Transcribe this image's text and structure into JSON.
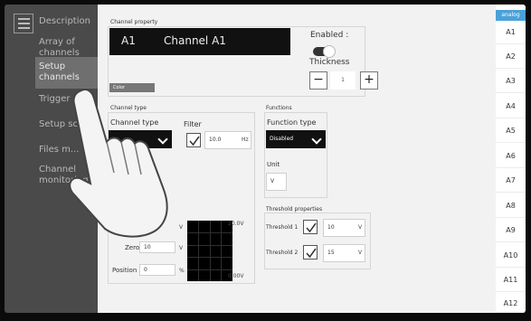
{
  "sidebar": {
    "items": [
      {
        "label": "Description"
      },
      {
        "label": "Array of channels"
      },
      {
        "label": "Setup channels"
      },
      {
        "label": "Trigger"
      },
      {
        "label": "Setup scre..."
      },
      {
        "label": "Files m..."
      },
      {
        "label": "Channel monitoring"
      }
    ]
  },
  "channel_property": {
    "title": "Channel property",
    "channel_id": "A1",
    "channel_name": "Channel A1",
    "enabled_label": "Enabled :",
    "thickness_label": "Thickness",
    "minus": "−",
    "thickness_value": "1",
    "plus": "+",
    "color_label": "Color"
  },
  "channel_type": {
    "title": "Channel type",
    "type_label": "Channel type",
    "filter_label": "Filter",
    "filter_value": "10.0",
    "filter_unit": "Hz",
    "gain_unit": "V",
    "zero_label": "Zero",
    "zero_value": "10",
    "zero_unit": "V",
    "position_label": "Position",
    "position_value": "0",
    "position_unit": "%",
    "scale_max": "20.0V",
    "scale_min": "0.00V"
  },
  "functions": {
    "title": "Functions",
    "type_label": "Function type",
    "type_value": "Disabled",
    "unit_label": "Unit",
    "unit_value": "V"
  },
  "threshold": {
    "title": "Threshold properties",
    "t1_label": "Threshold 1",
    "t1_value": "10",
    "t1_unit": "V",
    "t2_label": "Threshold 2",
    "t2_value": "15",
    "t2_unit": "V"
  },
  "tabs": {
    "header": "analog",
    "items": [
      "A1",
      "A2",
      "A3",
      "A4",
      "A5",
      "A6",
      "A7",
      "A8",
      "A9",
      "A10",
      "A11",
      "A12"
    ]
  }
}
